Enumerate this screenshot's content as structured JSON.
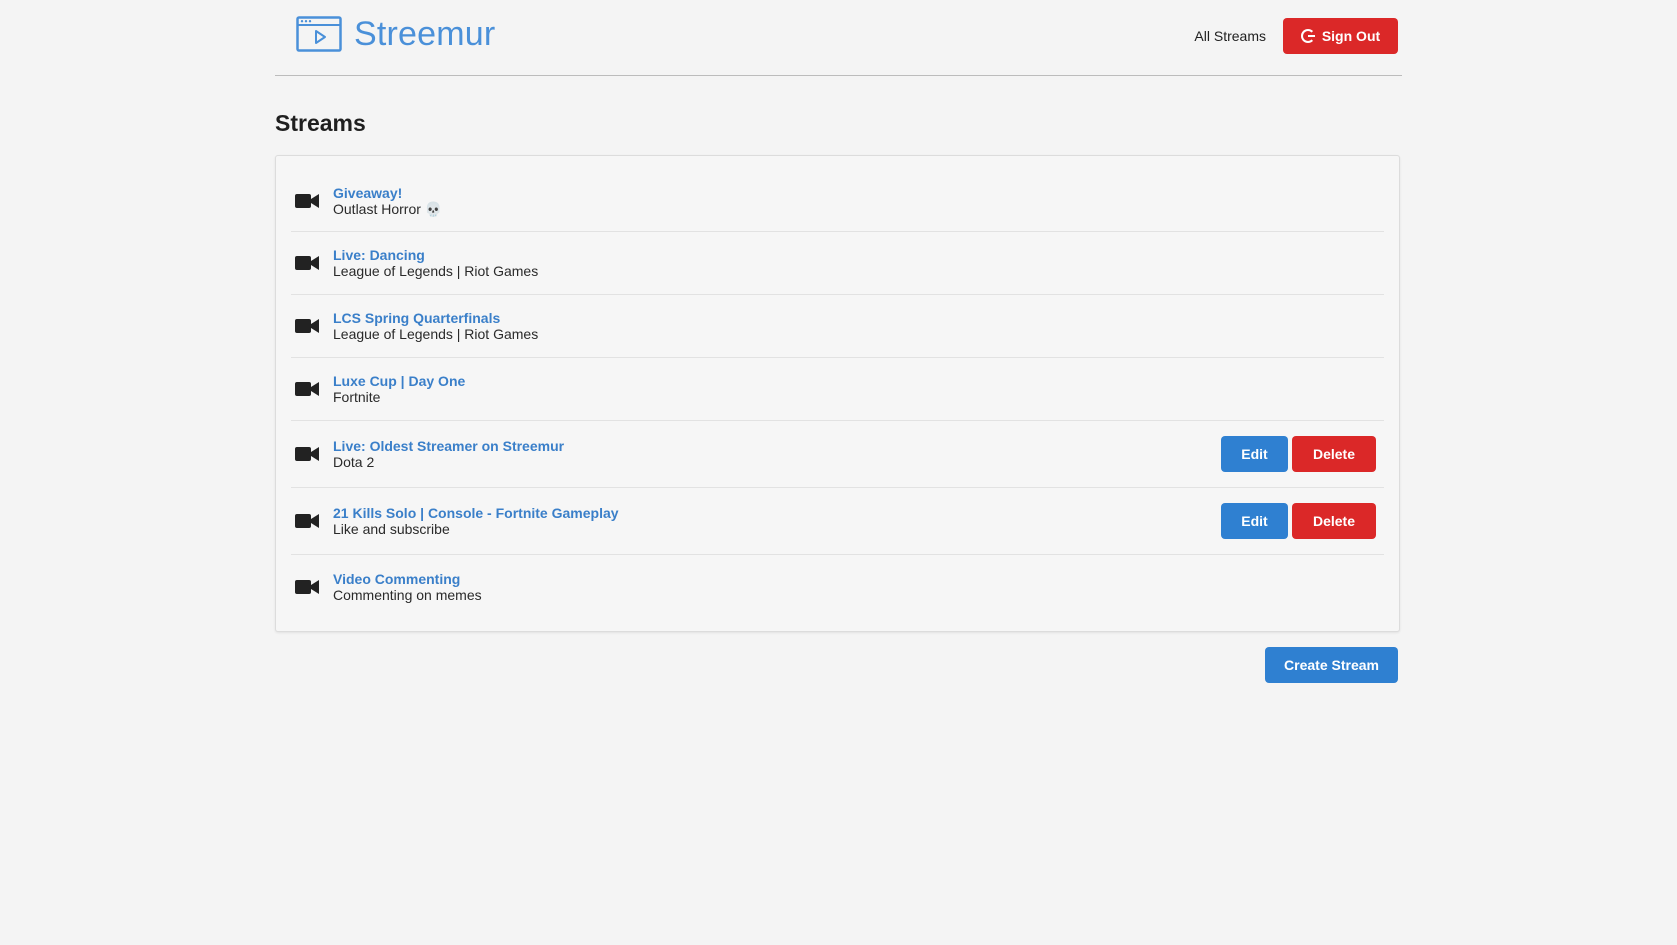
{
  "header": {
    "brand": "Streemur",
    "all_streams": "All Streams",
    "sign_out": "Sign Out"
  },
  "page": {
    "title": "Streams"
  },
  "streams": [
    {
      "title": "Giveaway!",
      "description": "Outlast Horror 💀"
    },
    {
      "title": "Live: Dancing",
      "description": "League of Legends | Riot Games"
    },
    {
      "title": "LCS Spring Quarterfinals",
      "description": "League of Legends | Riot Games"
    },
    {
      "title": "Luxe Cup | Day One",
      "description": "Fortnite"
    },
    {
      "title": "Live: Oldest Streamer on Streemur",
      "description": "Dota 2",
      "edit": "Edit",
      "delete": "Delete"
    },
    {
      "title": "21 Kills Solo | Console - Fortnite Gameplay",
      "description": "Like and subscribe",
      "edit": "Edit",
      "delete": "Delete"
    },
    {
      "title": "Video Commenting",
      "description": "Commenting on memes"
    }
  ],
  "footer": {
    "create_stream": "Create Stream"
  },
  "colors": {
    "accent": "#2f80d1",
    "danger": "#db2828",
    "link": "#3a7fc9",
    "background": "#f4f4f4"
  },
  "icons": {
    "brand": "video-window-icon",
    "sign_out": "google-icon",
    "stream": "video-camera-icon"
  }
}
